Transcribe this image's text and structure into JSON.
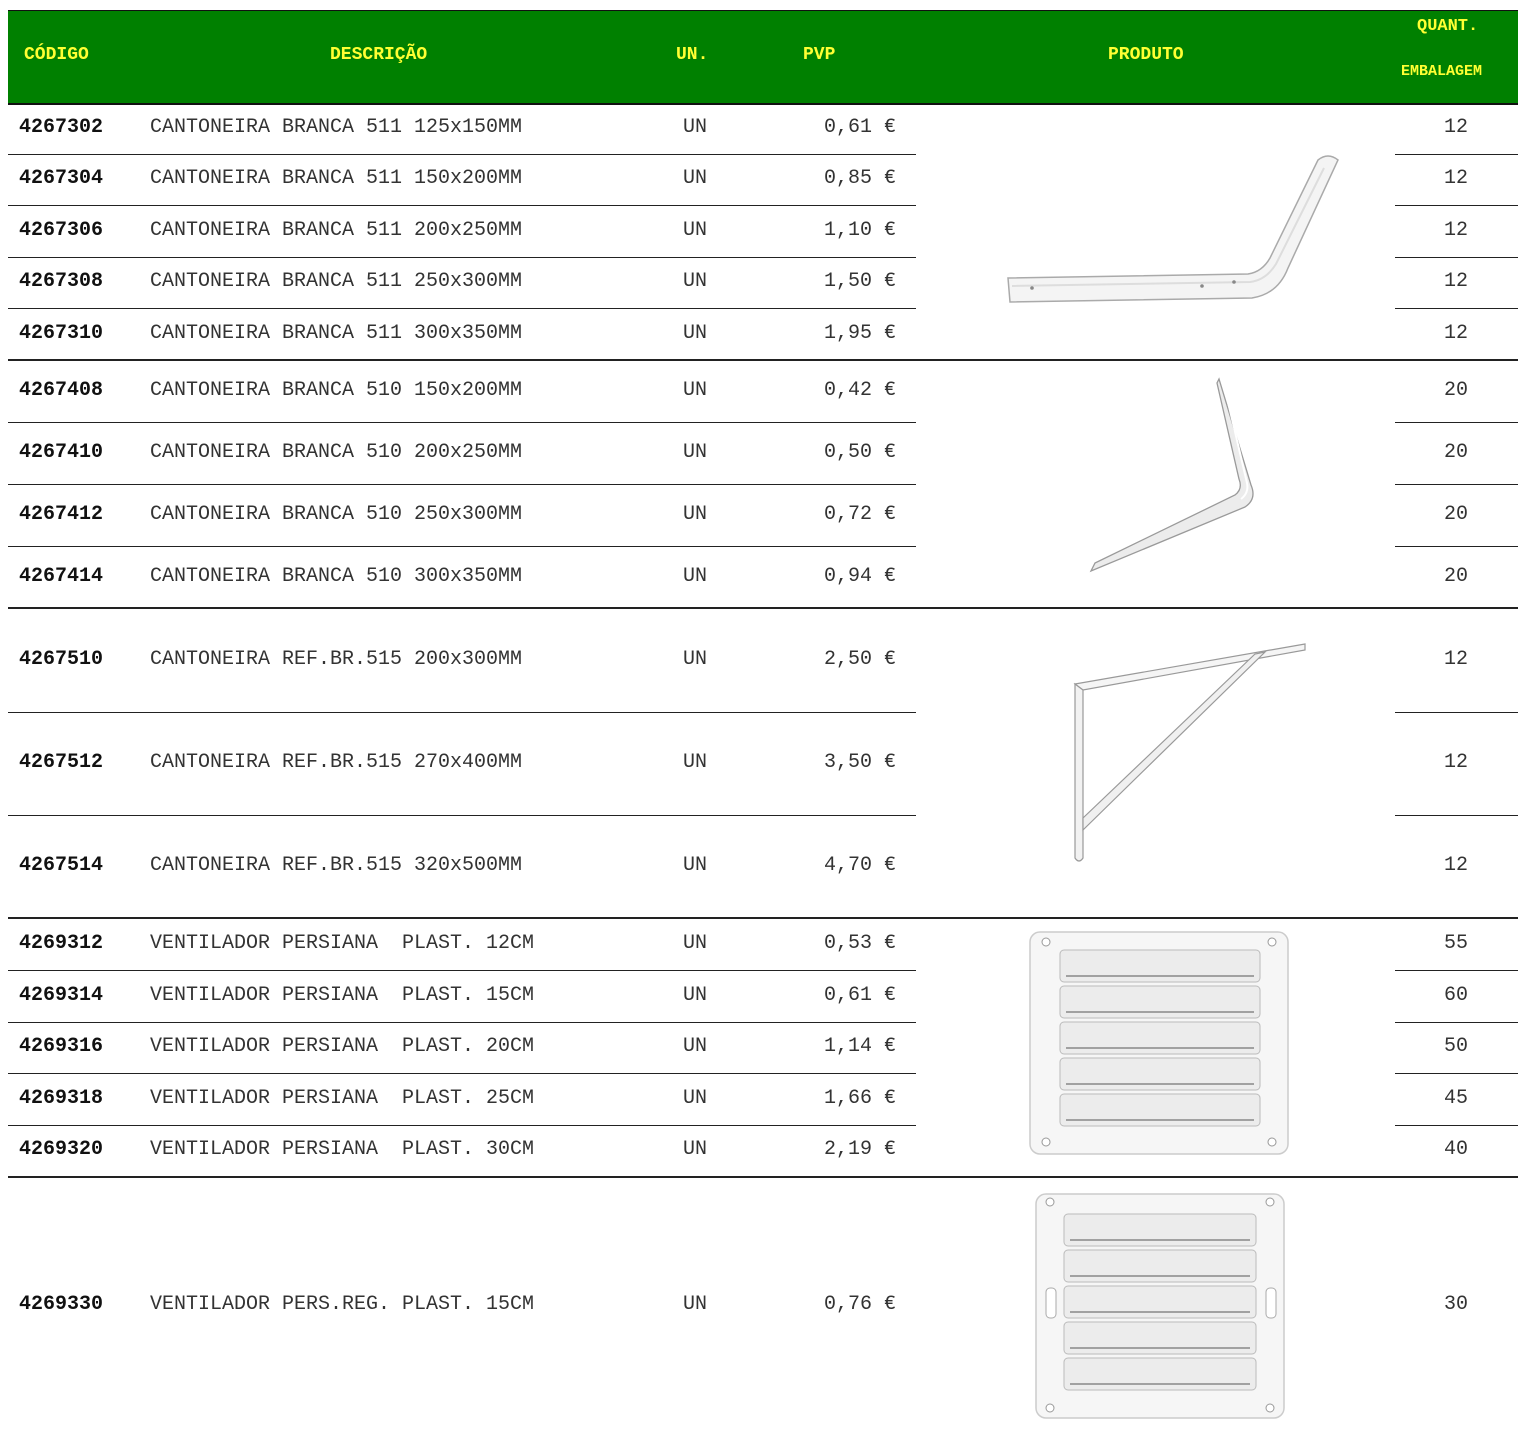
{
  "header": {
    "codigo": "CÓDIGO",
    "descricao": "DESCRIÇÃO",
    "un": "UN.",
    "pvp": "PVP",
    "produto": "PRODUTO",
    "quant": "QUANT.",
    "embalagem": "EMBALAGEM"
  },
  "colors": {
    "header_bg": "#008000",
    "header_text": "#ffff33"
  },
  "rows": [
    {
      "code": "4267302",
      "desc": "CANTONEIRA BRANCA 511 125x150MM",
      "un": "UN",
      "pvp": "0,61 €",
      "qty": "12"
    },
    {
      "code": "4267304",
      "desc": "CANTONEIRA BRANCA 511 150x200MM",
      "un": "UN",
      "pvp": "0,85 €",
      "qty": "12"
    },
    {
      "code": "4267306",
      "desc": "CANTONEIRA BRANCA 511 200x250MM",
      "un": "UN",
      "pvp": "1,10 €",
      "qty": "12"
    },
    {
      "code": "4267308",
      "desc": "CANTONEIRA BRANCA 511 250x300MM",
      "un": "UN",
      "pvp": "1,50 €",
      "qty": "12"
    },
    {
      "code": "4267310",
      "desc": "CANTONEIRA BRANCA 511 300x350MM",
      "un": "UN",
      "pvp": "1,95 €",
      "qty": "12"
    },
    {
      "code": "4267408",
      "desc": "CANTONEIRA BRANCA 510 150x200MM",
      "un": "UN",
      "pvp": "0,42 €",
      "qty": "20"
    },
    {
      "code": "4267410",
      "desc": "CANTONEIRA BRANCA 510 200x250MM",
      "un": "UN",
      "pvp": "0,50 €",
      "qty": "20"
    },
    {
      "code": "4267412",
      "desc": "CANTONEIRA BRANCA 510 250x300MM",
      "un": "UN",
      "pvp": "0,72 €",
      "qty": "20"
    },
    {
      "code": "4267414",
      "desc": "CANTONEIRA BRANCA 510 300x350MM",
      "un": "UN",
      "pvp": "0,94 €",
      "qty": "20"
    },
    {
      "code": "4267510",
      "desc": "CANTONEIRA REF.BR.515 200x300MM",
      "un": "UN",
      "pvp": "2,50 €",
      "qty": "12"
    },
    {
      "code": "4267512",
      "desc": "CANTONEIRA REF.BR.515 270x400MM",
      "un": "UN",
      "pvp": "3,50 €",
      "qty": "12"
    },
    {
      "code": "4267514",
      "desc": "CANTONEIRA REF.BR.515 320x500MM",
      "un": "UN",
      "pvp": "4,70 €",
      "qty": "12"
    },
    {
      "code": "4269312",
      "desc": "VENTILADOR PERSIANA  PLAST. 12CM",
      "un": "UN",
      "pvp": "0,53 €",
      "qty": "55"
    },
    {
      "code": "4269314",
      "desc": "VENTILADOR PERSIANA  PLAST. 15CM",
      "un": "UN",
      "pvp": "0,61 €",
      "qty": "60"
    },
    {
      "code": "4269316",
      "desc": "VENTILADOR PERSIANA  PLAST. 20CM",
      "un": "UN",
      "pvp": "1,14 €",
      "qty": "50"
    },
    {
      "code": "4269318",
      "desc": "VENTILADOR PERSIANA  PLAST. 25CM",
      "un": "UN",
      "pvp": "1,66 €",
      "qty": "45"
    },
    {
      "code": "4269320",
      "desc": "VENTILADOR PERSIANA  PLAST. 30CM",
      "un": "UN",
      "pvp": "2,19 €",
      "qty": "40"
    },
    {
      "code": "4269330",
      "desc": "VENTILADOR PERS.REG. PLAST. 15CM",
      "un": "UN",
      "pvp": "0,76 €",
      "qty": "30"
    }
  ],
  "products": [
    {
      "icon": "shelf-bracket-511-image"
    },
    {
      "icon": "shelf-bracket-510-image"
    },
    {
      "icon": "reinforced-bracket-515-image"
    },
    {
      "icon": "louvre-vent-image"
    },
    {
      "icon": "adjustable-louvre-vent-image"
    }
  ]
}
